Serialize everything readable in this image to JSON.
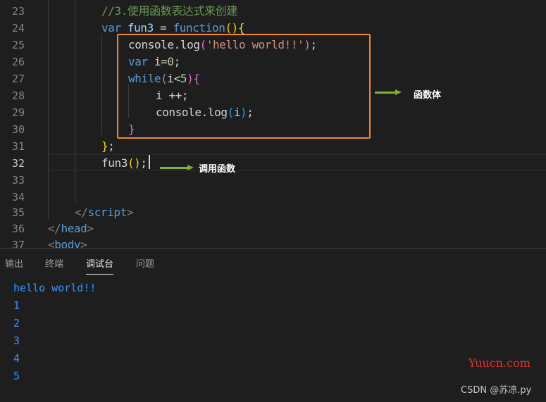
{
  "editor": {
    "line_numbers": [
      "23",
      "24",
      "25",
      "26",
      "27",
      "28",
      "29",
      "30",
      "31",
      "32",
      "33",
      "34",
      "35",
      "36",
      "37"
    ],
    "active_line": "32",
    "code": {
      "l23": "//3.使用函数表达式来创建",
      "l24": {
        "var": "var",
        "name": "fun3",
        "eq": " = ",
        "function": "function",
        "open": "()",
        "brace": "{"
      },
      "l25": {
        "obj": "console",
        "dot": ".",
        "method": "log",
        "lp": "(",
        "str": "'hello world!!'",
        "rp": ")",
        "semi": ";"
      },
      "l26": {
        "var": "var",
        "rest": " i=",
        "num": "0",
        "semi": ";"
      },
      "l27": {
        "while": "while",
        "lp": "(",
        "cond_a": "i<",
        "num": "5",
        "rp": ")",
        "brace": "{"
      },
      "l28": "i ++;",
      "l29": {
        "obj": "console",
        "dot": ".",
        "method": "log",
        "lp": "(",
        "arg": "i",
        "rp": ")",
        "semi": ";"
      },
      "l30": "}",
      "l31": {
        "brace": "}",
        "semi": ";"
      },
      "l32": {
        "name": "fun3",
        "call": "()",
        "semi": ";"
      },
      "l35": {
        "open": "</",
        "tag": "script",
        "close": ">"
      },
      "l36": {
        "open": "</",
        "tag": "head",
        "close": ">"
      },
      "l37": {
        "open": "<",
        "tag": "body",
        "close": ">"
      }
    }
  },
  "annotations": {
    "function_body": "函数体",
    "call_function": "调用函数"
  },
  "panel": {
    "tabs": [
      "输出",
      "终端",
      "调试台",
      "问题"
    ],
    "active_tab": "调试台",
    "output": [
      "hello world!!",
      "1",
      "2",
      "3",
      "4",
      "5"
    ]
  },
  "watermarks": {
    "site": "Yuucn.com",
    "credit": "CSDN @苏凉.py"
  },
  "colors": {
    "highlight_box": "#f0882e",
    "arrow": "#7bb52a",
    "console_output": "#3794ff"
  }
}
